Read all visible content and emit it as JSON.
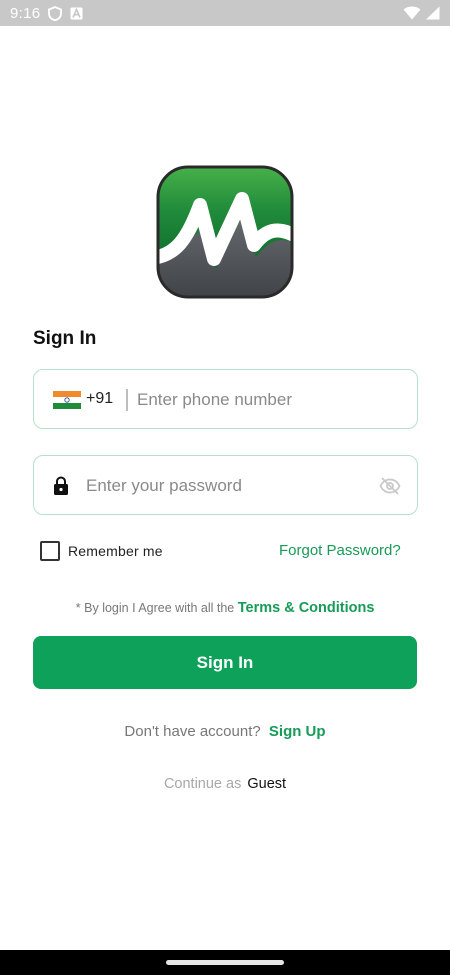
{
  "status_bar": {
    "time": "9:16",
    "icons": [
      "shield-icon",
      "a-letter-icon",
      "wifi-icon",
      "signal-icon"
    ]
  },
  "app": {
    "logo_icon": "m-logo-icon",
    "brand_colors": {
      "green": "#0ea15a",
      "logo_green": "#1f8a3a",
      "logo_gray": "#5f6368"
    }
  },
  "sign_in": {
    "title": "Sign In",
    "phone": {
      "flag_icon": "india-flag-icon",
      "country_code": "+91",
      "placeholder": "Enter phone number",
      "value": ""
    },
    "password": {
      "lock_icon": "lock-icon",
      "placeholder": "Enter your password",
      "value": "",
      "toggle_icon": "eye-off-icon"
    },
    "remember_label": "Remember me",
    "remember_checked": false,
    "forgot_label": "Forgot Password?",
    "terms_star": "*",
    "terms_text": "By login I Agree with all the",
    "terms_link": "Terms & Conditions",
    "button_label": "Sign In",
    "no_account_text": "Don't have account?",
    "signup_link": "Sign Up",
    "continue_text": "Continue as",
    "guest_link": "Guest"
  }
}
